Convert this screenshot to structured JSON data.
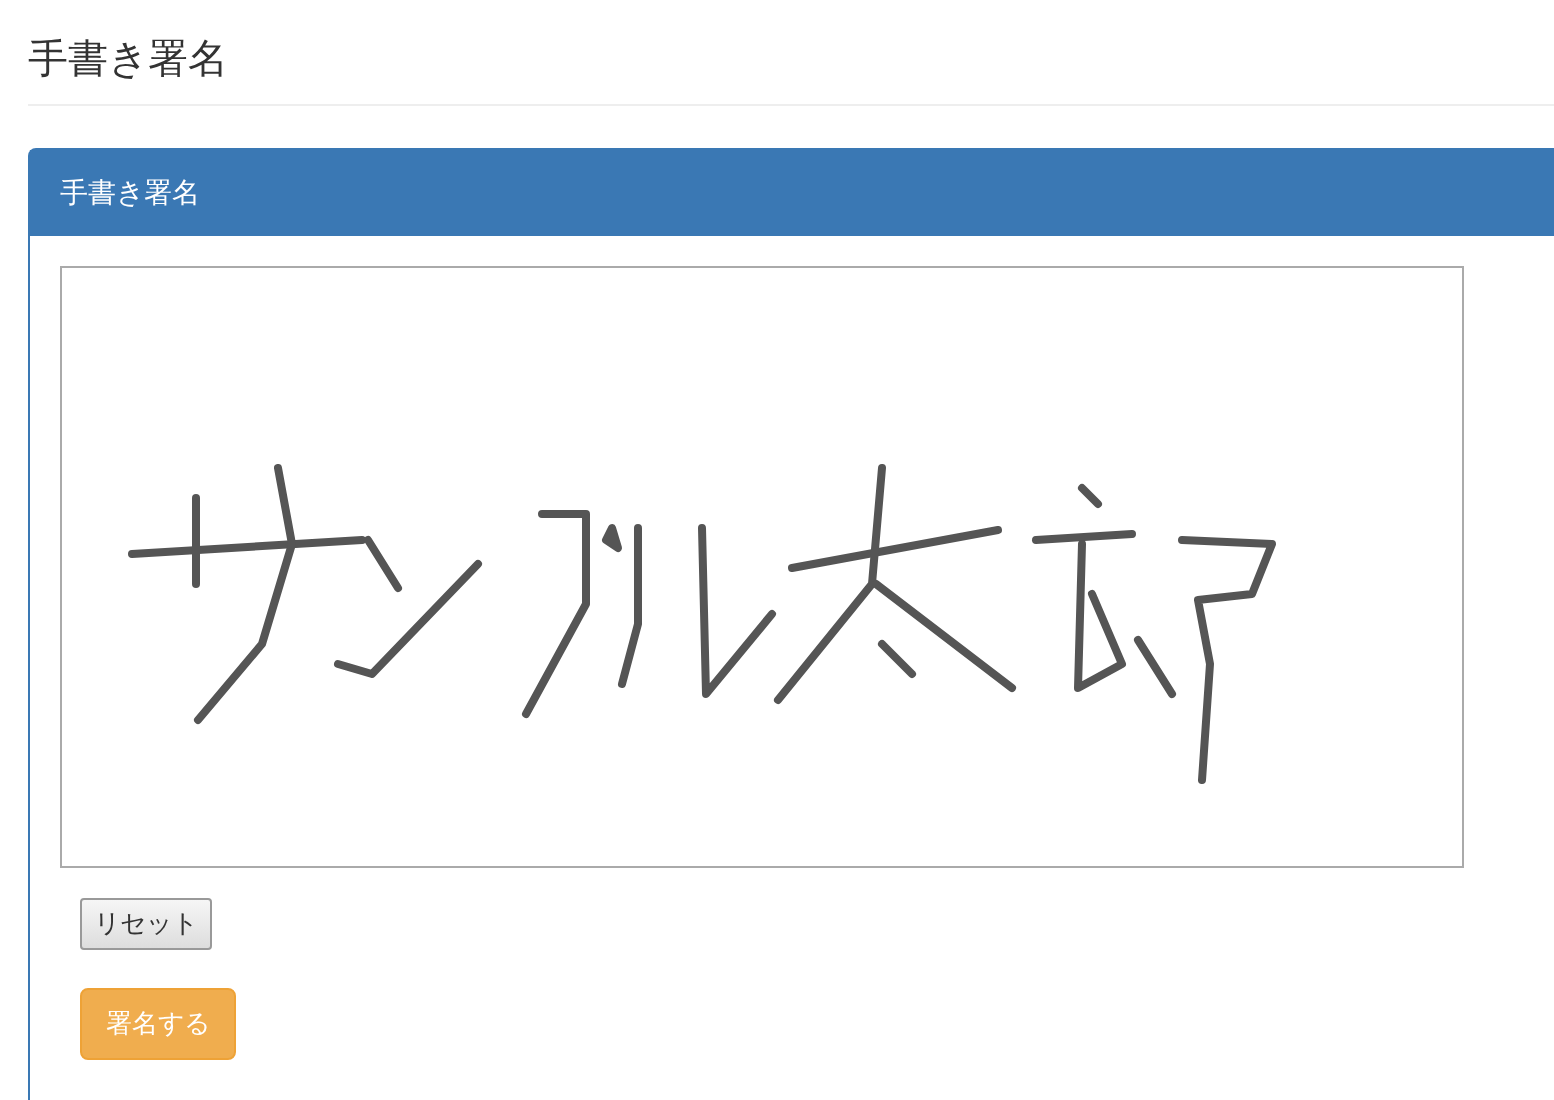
{
  "page_title": "手書き署名",
  "panel": {
    "title": "手書き署名"
  },
  "buttons": [
    {
      "label": "リセット",
      "kind": "default"
    },
    {
      "label": "署名する",
      "kind": "warning"
    }
  ]
}
